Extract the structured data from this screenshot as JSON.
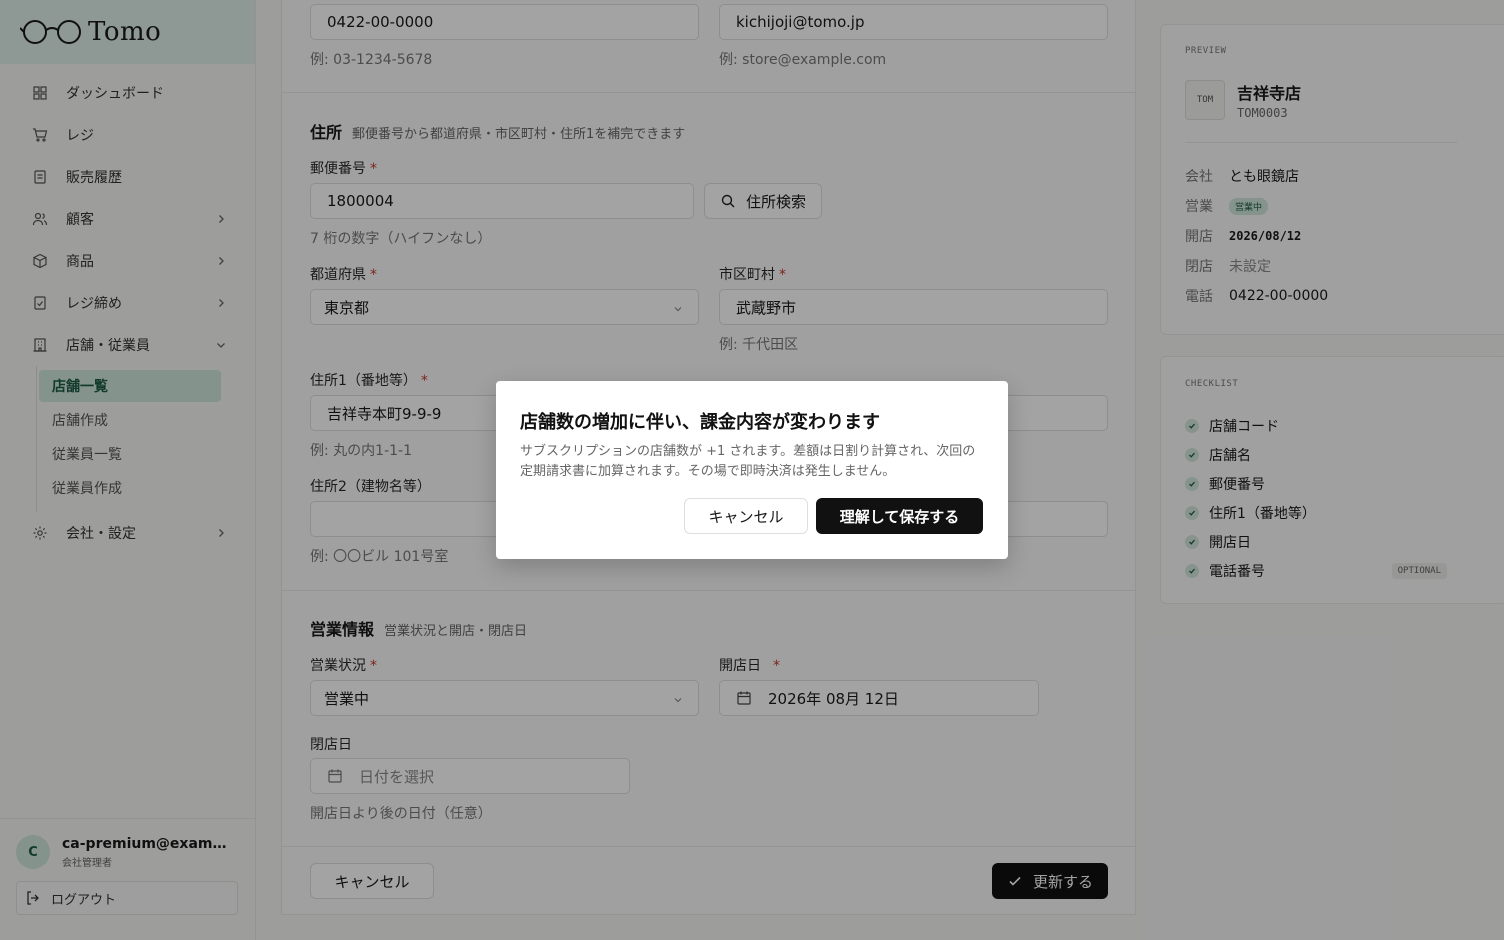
{
  "brand": {
    "name": "Tomo"
  },
  "sidebar": {
    "items": [
      {
        "label": "ダッシュボード",
        "icon": "dashboard-icon"
      },
      {
        "label": "レジ",
        "icon": "cart-icon"
      },
      {
        "label": "販売履歴",
        "icon": "receipt-icon"
      },
      {
        "label": "顧客",
        "icon": "users-icon",
        "has_children": true
      },
      {
        "label": "商品",
        "icon": "box-icon",
        "has_children": true
      },
      {
        "label": "レジ締め",
        "icon": "register-close-icon",
        "has_children": true
      },
      {
        "label": "店舗・従業員",
        "icon": "store-icon",
        "expanded": true
      },
      {
        "label": "会社・設定",
        "icon": "gear-icon",
        "has_children": true
      }
    ],
    "subitems": [
      {
        "label": "店舗一覧",
        "active": true
      },
      {
        "label": "店舗作成"
      },
      {
        "label": "従業員一覧"
      },
      {
        "label": "従業員作成"
      }
    ],
    "user": {
      "initial": "C",
      "email": "ca-premium@example.com",
      "role": "会社管理者"
    },
    "logout_label": "ログアウト"
  },
  "form": {
    "phone_value": "0422-00-0000",
    "phone_hint": "例: 03-1234-5678",
    "email_value": "kichijoji@tomo.jp",
    "email_hint": "例: store@example.com",
    "address": {
      "title": "住所",
      "subtitle": "郵便番号から都道府県・市区町村・住所1を補完できます",
      "postal_label": "郵便番号",
      "postal_value": "1800004",
      "postal_hint": "7 桁の数字（ハイフンなし）",
      "search_label": "住所検索",
      "prefecture_label": "都道府県",
      "prefecture_value": "東京都",
      "city_label": "市区町村",
      "city_value": "武蔵野市",
      "city_hint": "例: 千代田区",
      "address1_label": "住所1（番地等）",
      "address1_value": "吉祥寺本町9-9-9",
      "address1_hint": "例: 丸の内1-1-1",
      "address2_label": "住所2（建物名等）",
      "address2_value": "",
      "address2_hint": "例: 〇〇ビル 101号室"
    },
    "business": {
      "title": "営業情報",
      "subtitle": "営業状況と開店・閉店日",
      "status_label": "営業状況",
      "status_value": "営業中",
      "open_date_label": "開店日",
      "open_date_value": "2026年 08月 12日",
      "close_date_label": "閉店日",
      "close_date_placeholder": "日付を選択",
      "close_date_hint": "開店日より後の日付（任意）"
    },
    "cancel_label": "キャンセル",
    "submit_label": "更新する",
    "required_mark": "*"
  },
  "preview": {
    "heading": "PREVIEW",
    "avatar_text": "TOM",
    "store_name": "吉祥寺店",
    "store_code": "TOM0003",
    "rows": [
      {
        "key": "会社",
        "value": "とも眼鏡店"
      },
      {
        "key": "営業",
        "value": "営業中",
        "badge": true
      },
      {
        "key": "開店",
        "value": "2026/08/12",
        "mono": true
      },
      {
        "key": "閉店",
        "value": "未設定",
        "muted": true
      },
      {
        "key": "電話",
        "value": "0422-00-0000"
      }
    ]
  },
  "checklist": {
    "heading": "CHECKLIST",
    "items": [
      {
        "label": "店舗コード"
      },
      {
        "label": "店舗名"
      },
      {
        "label": "郵便番号"
      },
      {
        "label": "住所1（番地等）"
      },
      {
        "label": "開店日"
      },
      {
        "label": "電話番号",
        "tag": "OPTIONAL"
      }
    ]
  },
  "modal": {
    "title": "店舗数の増加に伴い、課金内容が変わります",
    "description": "サブスクリプションの店舗数が +1 されます。差額は日割り計算され、次回の定期請求書に加算されます。その場で即時決済は発生しません。",
    "cancel_label": "キャンセル",
    "confirm_label": "理解して保存する"
  },
  "colors": {
    "accent": "#cfe6dc",
    "accent_text": "#1e5b46",
    "brand_bg": "#dfeee8",
    "required": "#c0392b",
    "primary_button": "#111111"
  }
}
